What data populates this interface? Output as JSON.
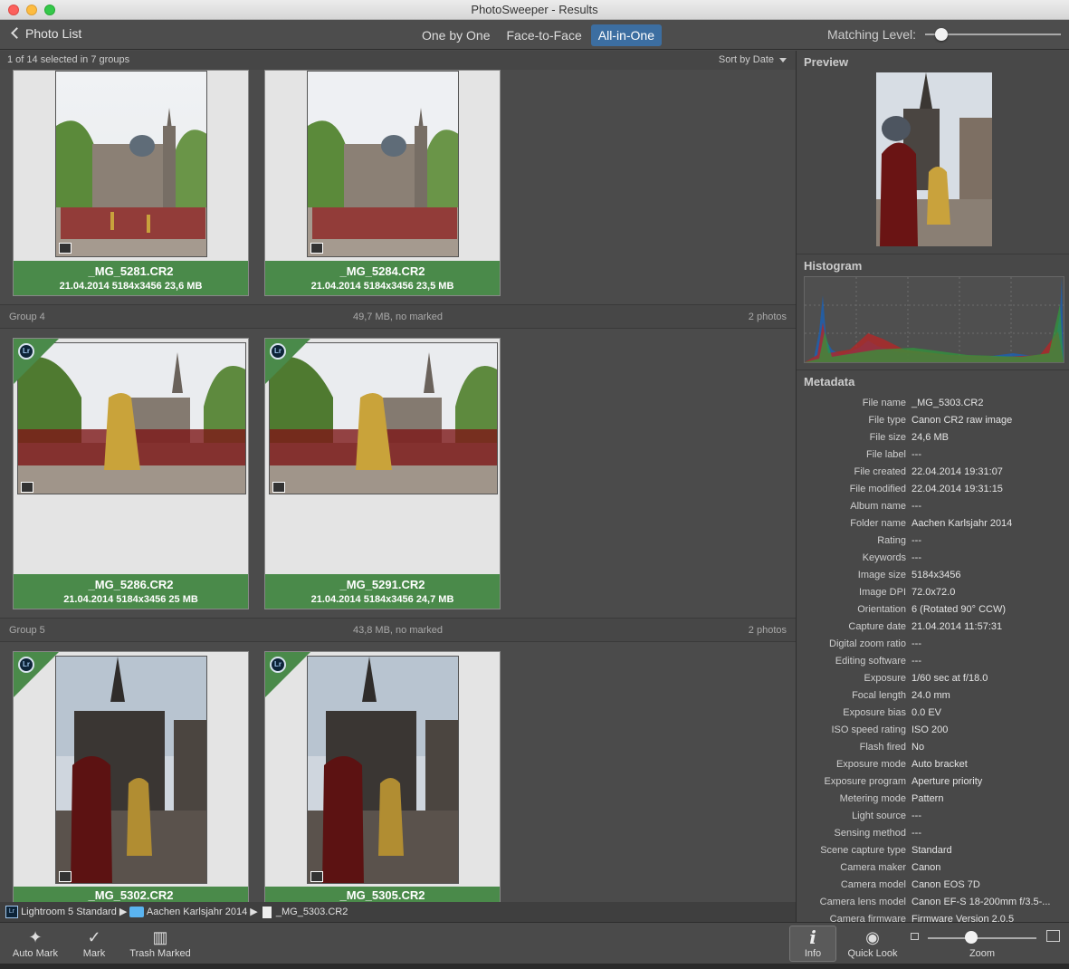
{
  "window": {
    "title": "PhotoSweeper - Results"
  },
  "toolbar": {
    "back_label": "Photo List",
    "modes": [
      "One by One",
      "Face-to-Face",
      "All-in-One"
    ],
    "active_mode": "All-in-One",
    "matching_label": "Matching Level:",
    "matching_level": 0.12
  },
  "info": {
    "selection": "1 of 14 selected in 7 groups",
    "sort": "Sort by Date"
  },
  "groups": [
    {
      "photos": [
        {
          "name": "_MG_5281.CR2",
          "meta": "21.04.2014  5184x3456  23,6 MB"
        },
        {
          "name": "_MG_5284.CR2",
          "meta": "21.04.2014  5184x3456  23,5 MB"
        }
      ]
    },
    {
      "name": "Group 4",
      "summary": "49,7 MB, no marked",
      "count": "2 photos",
      "photos": [
        {
          "name": "_MG_5286.CR2",
          "meta": "21.04.2014  5184x3456  25 MB",
          "lr": "Lr"
        },
        {
          "name": "_MG_5291.CR2",
          "meta": "21.04.2014  5184x3456  24,7 MB",
          "lr": "Lr"
        }
      ]
    },
    {
      "name": "Group 5",
      "summary": "43,8 MB, no marked",
      "count": "2 photos",
      "photos": [
        {
          "name": "_MG_5302.CR2",
          "lr": "Lr"
        },
        {
          "name": "_MG_5305.CR2",
          "lr": "Lr"
        }
      ]
    }
  ],
  "side": {
    "preview_title": "Preview",
    "histogram_title": "Histogram",
    "metadata_title": "Metadata",
    "metadata": [
      [
        "File name",
        "_MG_5303.CR2"
      ],
      [
        "File type",
        "Canon CR2 raw image"
      ],
      [
        "File size",
        "24,6 MB"
      ],
      [
        "File label",
        "---"
      ],
      [
        "File created",
        "22.04.2014 19:31:07"
      ],
      [
        "File modified",
        "22.04.2014 19:31:15"
      ],
      [
        "Album name",
        "---"
      ],
      [
        "Folder name",
        "Aachen Karlsjahr 2014"
      ],
      [
        "Rating",
        "---"
      ],
      [
        "Keywords",
        "---"
      ],
      [
        "Image size",
        "5184x3456"
      ],
      [
        "Image DPI",
        "72.0x72.0"
      ],
      [
        "Orientation",
        "6 (Rotated 90° CCW)"
      ],
      [
        "Capture date",
        "21.04.2014 11:57:31"
      ],
      [
        "Digital zoom ratio",
        "---"
      ],
      [
        "Editing software",
        "---"
      ],
      [
        "Exposure",
        "1/60 sec at f/18.0"
      ],
      [
        "Focal length",
        "24.0 mm"
      ],
      [
        "Exposure bias",
        "0.0 EV"
      ],
      [
        "ISO speed rating",
        "ISO 200"
      ],
      [
        "Flash fired",
        "No"
      ],
      [
        "Exposure mode",
        "Auto bracket"
      ],
      [
        "Exposure program",
        "Aperture priority"
      ],
      [
        "Metering mode",
        "Pattern"
      ],
      [
        "Light source",
        "---"
      ],
      [
        "Sensing method",
        "---"
      ],
      [
        "Scene capture type",
        "Standard"
      ],
      [
        "Camera maker",
        "Canon"
      ],
      [
        "Camera model",
        "Canon EOS 7D"
      ],
      [
        "Camera lens model",
        "Canon EF-S 18-200mm f/3.5-..."
      ],
      [
        "Camera firmware",
        "Firmware Version 2.0.5"
      ]
    ]
  },
  "path": {
    "lr_icon": "Lr",
    "lib": "Lightroom 5 Standard",
    "folder": "Aachen Karlsjahr 2014",
    "file": "_MG_5303.CR2"
  },
  "bottom": {
    "auto_mark": "Auto Mark",
    "mark": "Mark",
    "trash": "Trash Marked",
    "info": "Info",
    "info_glyph": "i",
    "quick_look": "Quick Look",
    "zoom": "Zoom",
    "zoom_level": 0.4
  },
  "colors": {
    "accent": "#3c6ea1",
    "card_caption": "#4a8a4a"
  }
}
